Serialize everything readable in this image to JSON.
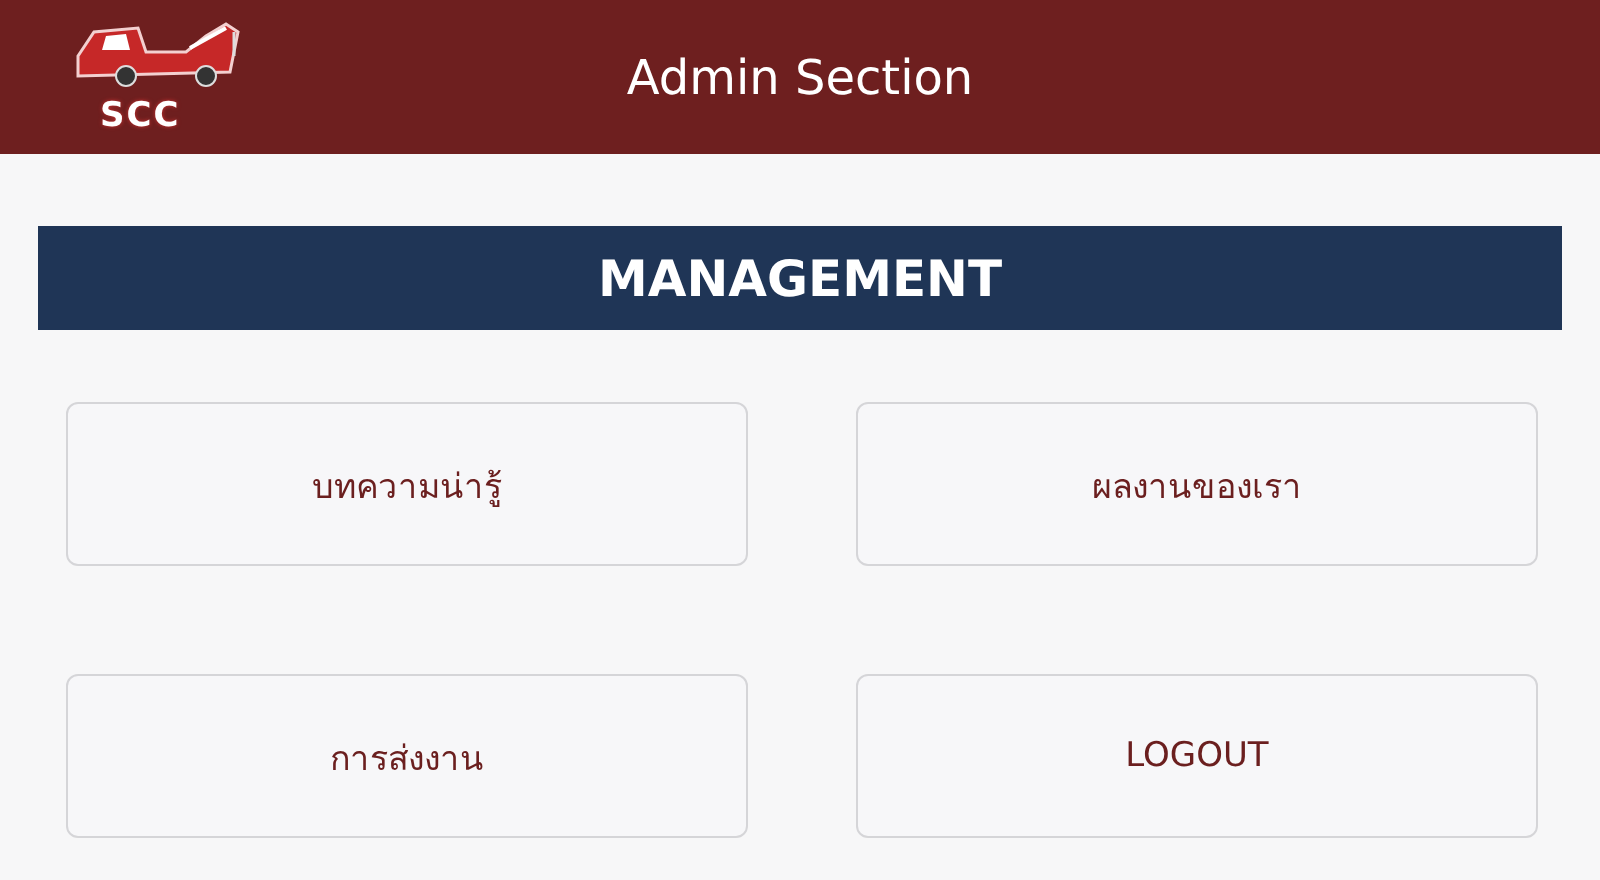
{
  "header": {
    "logo_text": "SCC",
    "title": "Admin Section"
  },
  "section": {
    "title": "MANAGEMENT"
  },
  "buttons": [
    {
      "label": "บทความน่ารู้"
    },
    {
      "label": "ผลงานของเรา"
    },
    {
      "label": "การส่งงาน"
    },
    {
      "label": "LOGOUT"
    }
  ]
}
